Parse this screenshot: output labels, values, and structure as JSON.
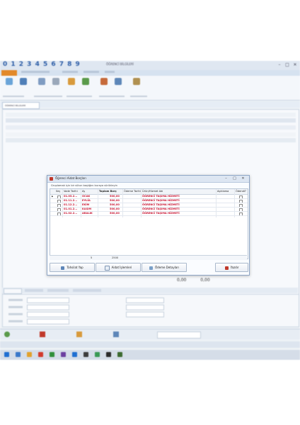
{
  "app": {
    "digits": "0 1 2 3 4 5 6 7 8 9",
    "title": "ÖĞRENCİ BİLGİLERİ",
    "doc_tab": "ÖĞRENCİ BİLGİLERİ"
  },
  "background": {
    "totals_left": "0,00",
    "totals_right": "0,00"
  },
  "modal": {
    "title": "Öğrenci Aidat Borçları",
    "group_hint": "Gruplamak için bir sütun başlığını buraya sürükleyin",
    "columns": [
      "Seç",
      "Vade Tarihi",
      "Ay",
      "Toplam Borç",
      "Ödeme Tarihi",
      "Ürün/Hizmet Adı",
      "Açıklama",
      "Ödendi?"
    ],
    "rows": [
      {
        "vade": "01.03.2...",
        "ay": "OCAK",
        "borc": "500,00",
        "odeme": "",
        "urun": "ÖĞRENCİ TAŞIMA HİZMETİ",
        "aciklama": ""
      },
      {
        "vade": "01.11.2...",
        "ay": "EYLÜL",
        "borc": "500,00",
        "odeme": "",
        "urun": "ÖĞRENCİ TAŞIMA HİZMETİ",
        "aciklama": ""
      },
      {
        "vade": "01.12.2...",
        "ay": "EKİM",
        "borc": "500,00",
        "odeme": "",
        "urun": "ÖĞRENCİ TAŞIMA HİZMETİ",
        "aciklama": ""
      },
      {
        "vade": "01.01.2...",
        "ay": "KASIM",
        "borc": "500,00",
        "odeme": "",
        "urun": "ÖĞRENCİ TAŞIMA HİZMETİ",
        "aciklama": ""
      },
      {
        "vade": "01.02.2...",
        "ay": "ARALIK",
        "borc": "500,00",
        "odeme": "",
        "urun": "ÖĞRENCİ TAŞIMA HİZMETİ",
        "aciklama": ""
      }
    ],
    "footer_count": "5",
    "footer_total": "2500",
    "buttons": {
      "tahsilat": "Tahsilat Yap",
      "aidat": "Aidat İşlemleri",
      "odeme": "Ödeme Detayları",
      "yazdir": "Yazdır"
    }
  },
  "colors": {
    "accent_text": "#c8102e",
    "title_digits": "#2f5fa8",
    "file_tab": "#e2892a"
  }
}
